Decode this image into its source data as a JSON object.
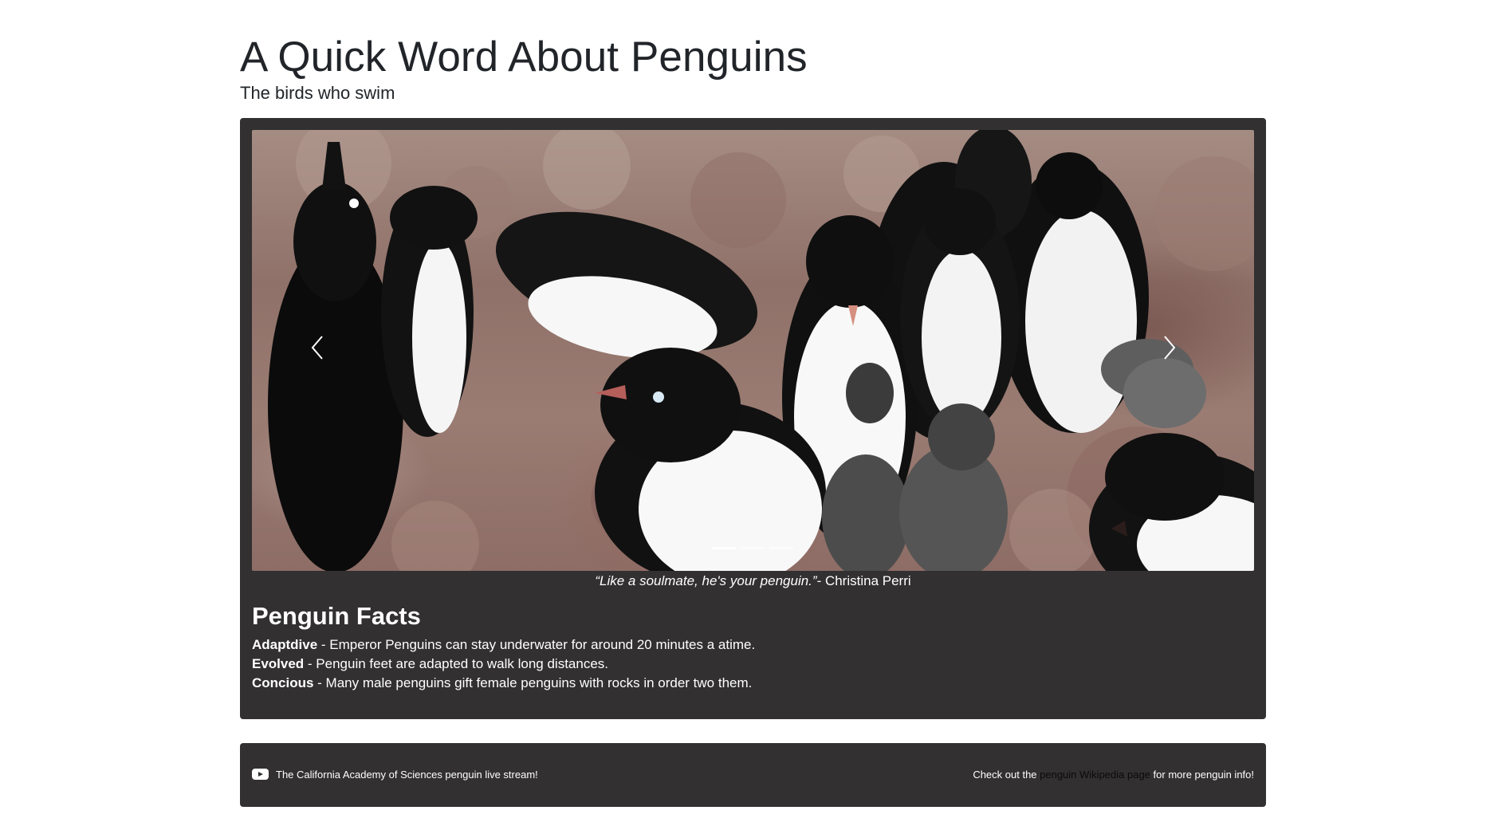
{
  "header": {
    "title": "A Quick Word About Penguins",
    "subtitle": "The birds who swim"
  },
  "carousel": {
    "slide_count": 3,
    "active_index": 0,
    "prev_icon": "chevron-left-icon",
    "next_icon": "chevron-right-icon"
  },
  "quote": {
    "text": "“Like a soulmate, he's your penguin.”",
    "author": "- Christina Perri"
  },
  "facts": {
    "title": "Penguin Facts",
    "items": [
      {
        "term": "Adaptdive",
        "text": " - Emperor Penguins can stay underwater for around 20 minutes a atime."
      },
      {
        "term": "Evolved",
        "text": " - Penguin feet are adapted to walk long distances."
      },
      {
        "term": "Concious",
        "text": " - Many male penguins gift female penguins with rocks in order two them."
      }
    ]
  },
  "footer": {
    "left_icon": "youtube-icon",
    "left_text": "The California Academy of Sciences penguin live stream!",
    "right_prefix": "Check out the ",
    "right_link": "penguin Wikipedia page",
    "right_suffix": " for more penguin info!"
  },
  "colors": {
    "card_background": "#323031",
    "page_background": "#ffffff",
    "text_dark": "#212529",
    "text_light": "#ffffff"
  }
}
